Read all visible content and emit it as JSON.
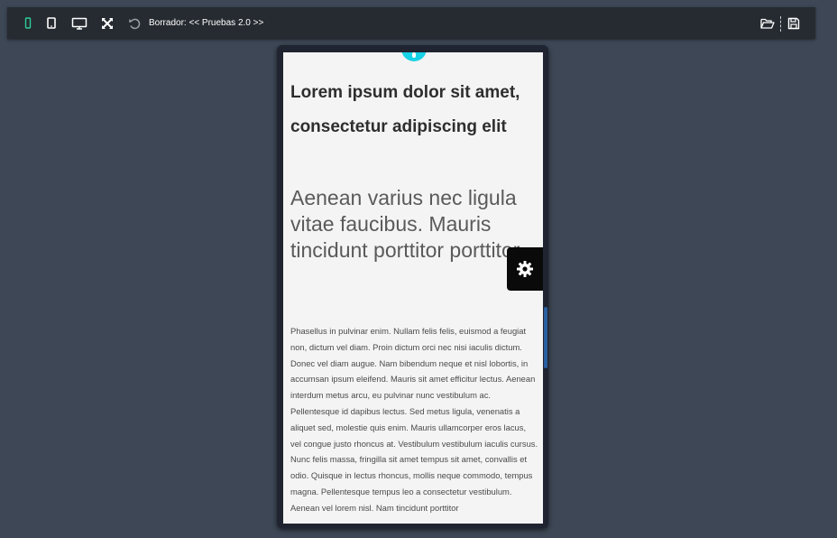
{
  "toolbar": {
    "title": "Borrador: << Pruebas 2.0 >>",
    "buttons": [
      {
        "name": "mobile-view",
        "icon": "mobile-icon",
        "active": true
      },
      {
        "name": "tablet-view",
        "icon": "tablet-icon"
      },
      {
        "name": "desktop-view",
        "icon": "desktop-icon"
      },
      {
        "name": "fullscreen",
        "icon": "fullscreen-icon"
      },
      {
        "name": "undo",
        "icon": "undo-icon"
      }
    ],
    "right_buttons": [
      {
        "name": "open-folder",
        "icon": "folder-open-icon"
      },
      {
        "name": "save",
        "icon": "save-icon"
      }
    ]
  },
  "content": {
    "heading": "Lorem ipsum dolor sit amet, consectetur adipiscing elit",
    "subheading": "Aenean varius nec ligula vitae faucibus. Mauris tincidunt porttitor porttitor",
    "paragraph": "Phasellus in pulvinar enim. Nullam felis felis, euismod a feugiat non, dictum vel diam. Proin dictum orci nec nisi iaculis dictum. Donec vel diam augue. Nam bibendum neque et nisl lobortis, in accumsan ipsum eleifend. Mauris sit amet efficitur lectus. Aenean interdum metus arcu, eu pulvinar nunc vestibulum ac. Pellentesque id dapibus lectus. Sed metus ligula, venenatis a aliquet sed, molestie quis enim. Mauris ullamcorper eros lacus, vel congue justo rhoncus at. Vestibulum vestibulum iaculis cursus. Nunc felis massa, fringilla sit amet tempus sit amet, convallis et odio. Quisque in lectus rhoncus, mollis neque commodo, tempus magna. Pellentesque tempus leo a consectetur vestibulum. Aenean vel lorem nisl. Nam tincidunt porttitor"
  },
  "colors": {
    "background": "#3d4755",
    "toolbar": "#262b31",
    "active_icon": "#2ecc9a",
    "accent_handle": "#17d2e6",
    "settings_button": "#0a0a0a"
  }
}
